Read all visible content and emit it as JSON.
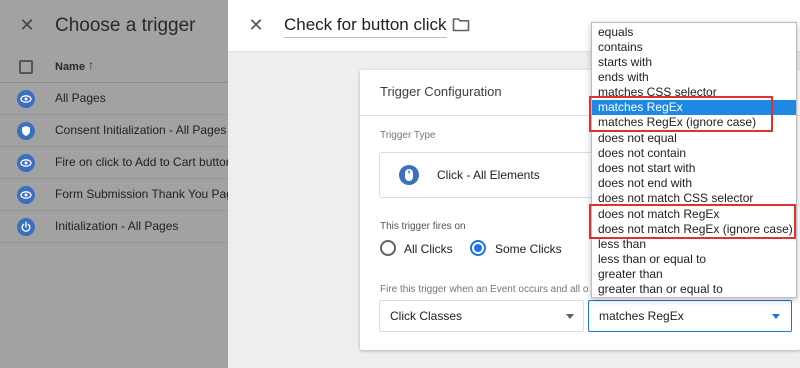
{
  "left_panel": {
    "title": "Choose a trigger",
    "column_name": "Name",
    "sort_arrow": "↑",
    "triggers": [
      {
        "label": "All Pages",
        "icon": "eye-icon"
      },
      {
        "label": "Consent Initialization - All Pages",
        "icon": "shield-icon"
      },
      {
        "label": "Fire on click to Add to Cart button",
        "icon": "eye-icon"
      },
      {
        "label": "Form Submission Thank You Page",
        "icon": "eye-icon"
      },
      {
        "label": "Initialization - All Pages",
        "icon": "power-icon"
      }
    ]
  },
  "main": {
    "title": "Check for button click",
    "card": {
      "title": "Trigger Configuration",
      "type_label": "Trigger Type",
      "type_value": "Click - All Elements",
      "fires_label": "This trigger fires on",
      "radio_all": "All Clicks",
      "radio_some": "Some Clicks",
      "radio_selected": "Some Clicks",
      "fire_when": "Fire this trigger when an Event occurs and all o",
      "variable": "Click Classes",
      "operator": "matches RegEx"
    }
  },
  "dropdown": {
    "options": [
      "equals",
      "contains",
      "starts with",
      "ends with",
      "matches CSS selector",
      "matches RegEx",
      "matches RegEx (ignore case)",
      "does not equal",
      "does not contain",
      "does not start with",
      "does not end with",
      "does not match CSS selector",
      "does not match RegEx",
      "does not match RegEx (ignore case)",
      "less than",
      "less than or equal to",
      "greater than",
      "greater than or equal to"
    ],
    "selected": "matches RegEx"
  },
  "colors": {
    "accent": "#1a73e8",
    "selected_bg": "#1e88e5",
    "annotation_red": "#e03030",
    "icon_blue": "#3b6fbf"
  }
}
